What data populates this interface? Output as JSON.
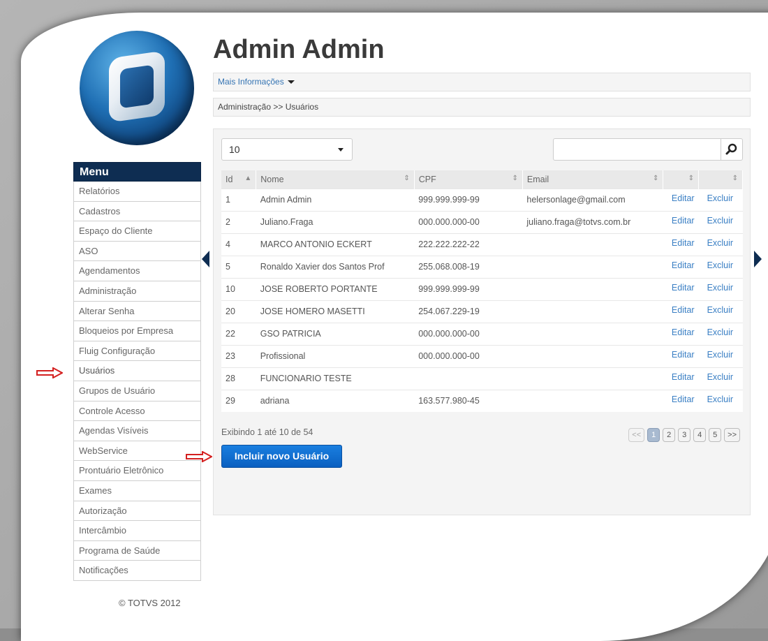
{
  "page": {
    "title": "Admin Admin"
  },
  "header": {
    "more_info": "Mais Informações",
    "breadcrumb": "Administração >> Usuários"
  },
  "menu": {
    "title": "Menu",
    "items": [
      "Relatórios",
      "Cadastros",
      "Espaço do Cliente",
      "ASO",
      "Agendamentos",
      "Administração",
      "Alterar Senha",
      "Bloqueios por Empresa",
      "Fluig Configuração",
      "Usuários",
      "Grupos de Usuário",
      "Controle Acesso",
      "Agendas Visíveis",
      "WebService",
      "Prontuário Eletrônico",
      "Exames",
      "Autorização",
      "Intercâmbio",
      "Programa de Saúde",
      "Notificações"
    ],
    "active": "Usuários"
  },
  "footer": "© TOTVS 2012",
  "table": {
    "page_size": "10",
    "columns": [
      "Id",
      "Nome",
      "CPF",
      "Email"
    ],
    "rows": [
      {
        "id": "1",
        "nome": "Admin Admin",
        "cpf": "999.999.999-99",
        "email": "helersonlage@gmail.com"
      },
      {
        "id": "2",
        "nome": "Juliano.Fraga",
        "cpf": "000.000.000-00",
        "email": "juliano.fraga@totvs.com.br"
      },
      {
        "id": "4",
        "nome": "MARCO ANTONIO ECKERT",
        "cpf": "222.222.222-22",
        "email": ""
      },
      {
        "id": "5",
        "nome": "Ronaldo Xavier dos Santos Prof",
        "cpf": "255.068.008-19",
        "email": ""
      },
      {
        "id": "10",
        "nome": "JOSE ROBERTO PORTANTE",
        "cpf": "999.999.999-99",
        "email": ""
      },
      {
        "id": "20",
        "nome": "JOSE HOMERO MASETTI",
        "cpf": "254.067.229-19",
        "email": ""
      },
      {
        "id": "22",
        "nome": "GSO PATRICIA",
        "cpf": "000.000.000-00",
        "email": ""
      },
      {
        "id": "23",
        "nome": "Profissional",
        "cpf": "000.000.000-00",
        "email": ""
      },
      {
        "id": "28",
        "nome": "FUNCIONARIO TESTE",
        "cpf": "",
        "email": ""
      },
      {
        "id": "29",
        "nome": "adriana",
        "cpf": "163.577.980-45",
        "email": ""
      }
    ],
    "edit_label": "Editar",
    "delete_label": "Excluir",
    "info": "Exibindo 1 até 10 de 54"
  },
  "pagination": {
    "prev": "<<",
    "pages": [
      "1",
      "2",
      "3",
      "4",
      "5"
    ],
    "next": ">>",
    "current": "1"
  },
  "new_user_button": "Incluir novo Usuário",
  "icons": {
    "search": "search-icon",
    "sort": "sort-icon",
    "arrow": "red-arrow-icon"
  },
  "colors": {
    "menu_header": "#0e2d52",
    "link": "#3a7fc4",
    "button": "#0a5fc0",
    "arrow": "#d42020"
  }
}
